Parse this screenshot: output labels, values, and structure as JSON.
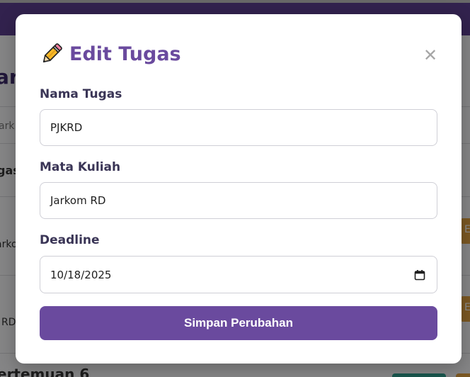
{
  "background": {
    "page_title_fragment": "ar",
    "search_fragment": "ark",
    "column_header_fragment": "gas",
    "row1_fragment": "arko",
    "row2_fragment": "RD",
    "edit_fragment": "E",
    "section_fragment": "ertemuan 6"
  },
  "modal": {
    "title": "Edit Tugas",
    "close_symbol": "✕",
    "fields": {
      "nama_tugas": {
        "label": "Nama Tugas",
        "value": "PJKRD"
      },
      "mata_kuliah": {
        "label": "Mata Kuliah",
        "value": "Jarkom RD"
      },
      "deadline": {
        "label": "Deadline",
        "value": "10/18/2025"
      }
    },
    "submit_label": "Simpan Perubahan"
  },
  "colors": {
    "accent": "#6a4a9e",
    "header": "#5c3f8f",
    "edit_button": "#e0a041"
  },
  "icons": {
    "title_icon": "pencil-icon",
    "close_icon": "close-icon",
    "date_icon": "calendar-icon"
  }
}
